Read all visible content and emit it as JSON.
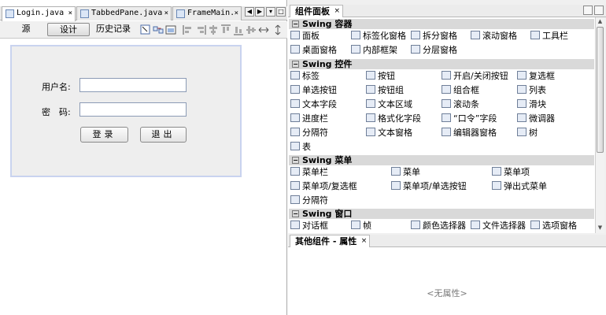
{
  "editor": {
    "tabs": [
      {
        "label": "Login.java",
        "close": "×"
      },
      {
        "label": "TabbedPane.java",
        "close": "×"
      },
      {
        "label": "FrameMain.",
        "close": "×"
      }
    ],
    "nav": {
      "left": "◀",
      "right": "▶",
      "list": "▾",
      "max": "□"
    },
    "modes": {
      "source": "源",
      "design": "设计",
      "history": "历史记录"
    },
    "toolbar_icons": [
      "selection-mode-icon",
      "connection-mode-icon",
      "preview-icon",
      "align-left-icon",
      "align-right-icon",
      "center-horizontal-icon",
      "align-top-icon",
      "align-bottom-icon",
      "center-vertical-icon",
      "resize-width-icon",
      "resize-height-icon"
    ]
  },
  "form": {
    "username_label": "用户名:",
    "password_label": "密　码:",
    "username_value": "",
    "password_value": "",
    "login_button": "登录",
    "exit_button": "退出"
  },
  "palette": {
    "title": "组件面板",
    "close": "×",
    "controls": [
      "标签",
      "按钮",
      "开启/关闭按钮",
      "复选框",
      "单选按钮",
      "按钮组",
      "组合框",
      "列表",
      "文本字段",
      "文本区域",
      "滚动条",
      "滑块",
      "进度栏",
      "格式化字段",
      "“口令”字段",
      "微调器",
      "分隔符",
      "文本窗格",
      "编辑器窗格",
      "树",
      "表"
    ],
    "categories": {
      "containers": "Swing 容器",
      "controls": "Swing 控件",
      "menus": "Swing 菜单",
      "windows": "Swing 窗口"
    },
    "containers": [
      "面板",
      "标签化窗格",
      "拆分窗格",
      "滚动窗格",
      "工具栏",
      "桌面窗格",
      "内部框架",
      "分层窗格"
    ],
    "menus": [
      "菜单栏",
      "菜单",
      "菜单项",
      "菜单项/复选框",
      "菜单项/单选按钮",
      "弹出式菜单",
      "分隔符"
    ],
    "windows": [
      "对话框",
      "帧",
      "颜色选择器",
      "文件选择器",
      "选项窗格"
    ]
  },
  "properties": {
    "title": "其他组件 - 属性",
    "close": "×",
    "empty": "<无属性>"
  }
}
